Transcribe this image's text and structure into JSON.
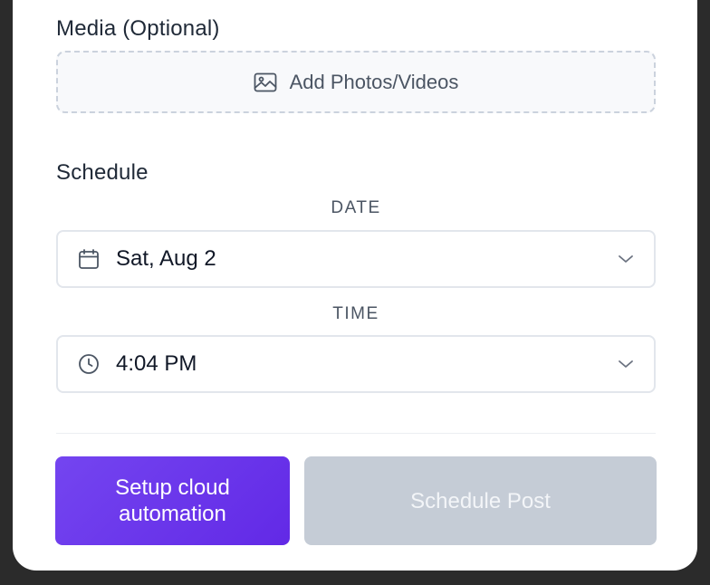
{
  "media": {
    "label": "Media (Optional)",
    "add_button_label": "Add Photos/Videos",
    "add_icon": "image-icon"
  },
  "schedule": {
    "label": "Schedule",
    "date": {
      "caption": "DATE",
      "value": "Sat, Aug 2",
      "icon": "calendar-icon"
    },
    "time": {
      "caption": "TIME",
      "value": "4:04 PM",
      "icon": "clock-icon"
    }
  },
  "actions": {
    "cloud_label": "Setup cloud automation",
    "schedule_label": "Schedule Post"
  },
  "colors": {
    "accent": "#6a35ea",
    "disabled_button": "#c5ccd6"
  }
}
